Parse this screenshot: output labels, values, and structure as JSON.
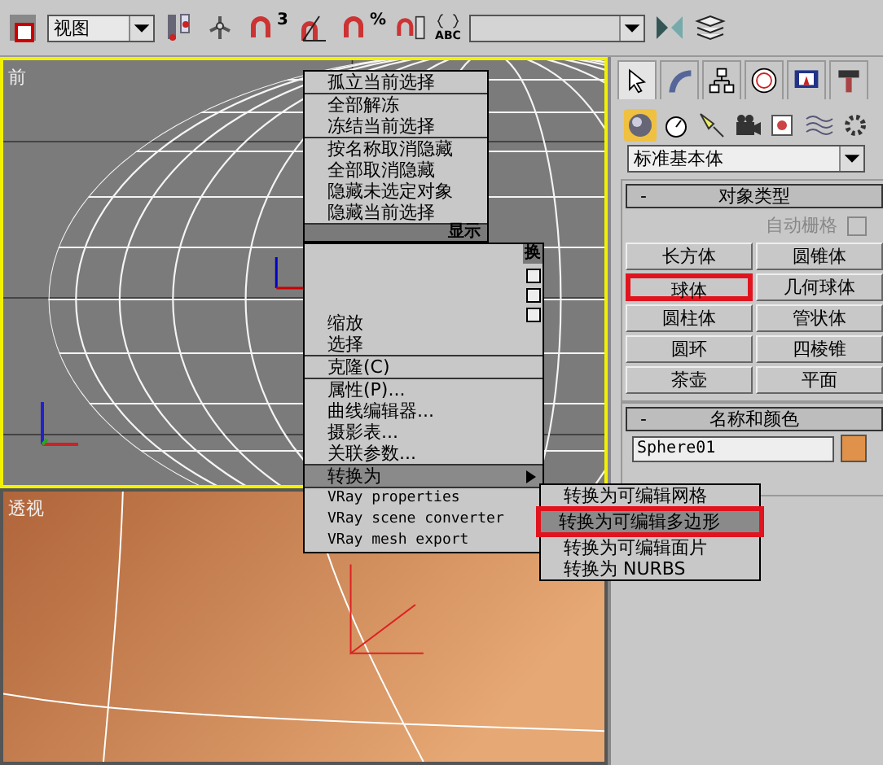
{
  "toolbar": {
    "view_dropdown": {
      "value": "视图"
    },
    "snap_labels": [
      "3",
      "%"
    ],
    "selection_set_label": "ABC"
  },
  "viewports": [
    {
      "label": "前",
      "kind": "wire",
      "active": true
    },
    {
      "label": "透视",
      "kind": "shaded",
      "active": false
    }
  ],
  "quad_menu": {
    "top_left": {
      "title": "显示",
      "items": [
        {
          "label": "孤立当前选择",
          "separator_before": false
        },
        {
          "label": "全部解冻",
          "separator_before": true
        },
        {
          "label": "冻结当前选择",
          "separator_before": false
        },
        {
          "label": "按名称取消隐藏",
          "separator_before": true
        },
        {
          "label": "全部取消隐藏",
          "separator_before": false
        },
        {
          "label": "隐藏未选定对象",
          "separator_before": false
        },
        {
          "label": "隐藏当前选择",
          "separator_before": false
        }
      ]
    },
    "top_right_title": "换",
    "bottom_left": {
      "items": [
        {
          "label": "缩放",
          "separator_before": false,
          "selected": false,
          "submenu": false,
          "kind": "text"
        },
        {
          "label": "选择",
          "separator_before": false,
          "selected": false,
          "submenu": false,
          "kind": "text"
        },
        {
          "label": "克隆(C)",
          "separator_before": true,
          "selected": false,
          "submenu": false,
          "kind": "text"
        },
        {
          "label": "属性(P)...",
          "separator_before": true,
          "selected": false,
          "submenu": false,
          "kind": "text"
        },
        {
          "label": "曲线编辑器...",
          "separator_before": false,
          "selected": false,
          "submenu": false,
          "kind": "text"
        },
        {
          "label": "摄影表...",
          "separator_before": false,
          "selected": false,
          "submenu": false,
          "kind": "text"
        },
        {
          "label": "关联参数...",
          "separator_before": false,
          "selected": false,
          "submenu": false,
          "kind": "text"
        },
        {
          "label": "转换为",
          "separator_before": true,
          "selected": true,
          "submenu": true,
          "kind": "text"
        },
        {
          "label": "VRay properties",
          "separator_before": true,
          "selected": false,
          "submenu": false,
          "kind": "mono"
        },
        {
          "label": "VRay scene converter",
          "separator_before": false,
          "selected": false,
          "submenu": false,
          "kind": "mono"
        },
        {
          "label": "VRay mesh export",
          "separator_before": false,
          "selected": false,
          "submenu": false,
          "kind": "mono"
        }
      ]
    },
    "submenu": {
      "items": [
        {
          "label": "转换为可编辑网格",
          "selected": false,
          "highlighted": false
        },
        {
          "label": "转换为可编辑多边形",
          "selected": true,
          "highlighted": true
        },
        {
          "label": "转换为可编辑面片",
          "selected": false,
          "highlighted": false
        },
        {
          "label": "转换为 NURBS",
          "selected": false,
          "highlighted": false
        }
      ]
    }
  },
  "command_panel": {
    "category_dropdown": {
      "value": "标准基本体"
    },
    "object_type": {
      "title": "对象类型",
      "collapse": "-",
      "auto_grid": {
        "label": "自动栅格",
        "checked": false,
        "disabled": true
      },
      "buttons": [
        {
          "label": "长方体",
          "highlighted": false
        },
        {
          "label": "圆锥体",
          "highlighted": false
        },
        {
          "label": "球体",
          "highlighted": true
        },
        {
          "label": "几何球体",
          "highlighted": false
        },
        {
          "label": "圆柱体",
          "highlighted": false
        },
        {
          "label": "管状体",
          "highlighted": false
        },
        {
          "label": "圆环",
          "highlighted": false
        },
        {
          "label": "四棱锥",
          "highlighted": false
        },
        {
          "label": "茶壶",
          "highlighted": false
        },
        {
          "label": "平面",
          "highlighted": false
        }
      ]
    },
    "name_and_color": {
      "title": "名称和颜色",
      "collapse": "-",
      "name": "Sphere01",
      "color": "#e0924a"
    }
  }
}
